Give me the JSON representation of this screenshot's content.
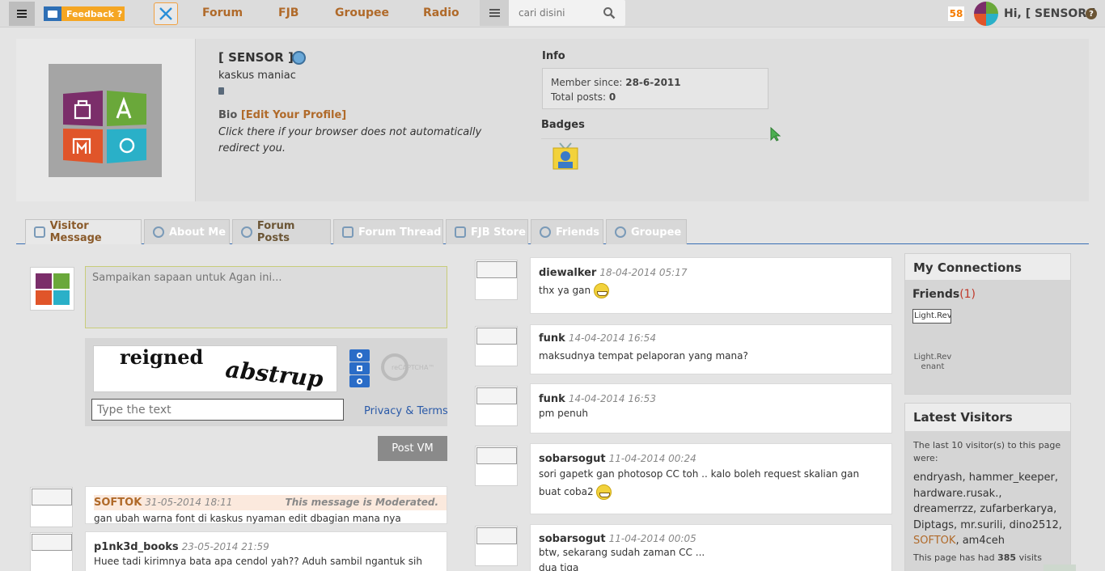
{
  "topbar": {
    "feedback_label": "Feedback ?",
    "nav": [
      "Forum",
      "FJB",
      "Groupee",
      "Radio"
    ],
    "search_placeholder": "cari disini",
    "notification_count": "58",
    "greeting": "Hi, [ SENSOR ]",
    "help_label": "?"
  },
  "profile": {
    "username": "[ SENSOR ]",
    "title": "kaskus maniac",
    "bio_label": "Bio",
    "edit_profile": "[Edit Your Profile]",
    "bio_text": "Click there if your browser does not automatically redirect you.",
    "info_title": "Info",
    "member_since_label": "Member since:",
    "member_since": "28-6-2011",
    "total_posts_label": "Total posts:",
    "total_posts": "0",
    "badges_title": "Badges"
  },
  "tabs": [
    {
      "label": "Visitor Message",
      "icon": "note-icon",
      "active": true
    },
    {
      "label": "About Me",
      "icon": "person-icon",
      "active": false
    },
    {
      "label": "Forum Posts",
      "icon": "chat-bubble-icon",
      "active": false
    },
    {
      "label": "Forum Thread",
      "icon": "calendar-icon",
      "active": false
    },
    {
      "label": "FJB Store",
      "icon": "cart-icon",
      "active": false
    },
    {
      "label": "Friends",
      "icon": "friend-icon",
      "active": false
    },
    {
      "label": "Groupee",
      "icon": "group-icon",
      "active": false
    }
  ],
  "visitor_message": {
    "placeholder": "Sampaikan sapaan untuk Agan ini...",
    "captcha_words": [
      "reigned",
      "abstrup"
    ],
    "captcha_placeholder": "Type the text",
    "recaptcha_label": "reCAPTCHA™",
    "privacy_terms": "Privacy & Terms",
    "post_button": "Post VM"
  },
  "left_messages": [
    {
      "user": "SOFTOK",
      "date": "31-05-2014 18:11",
      "moderated": "This message is Moderated.",
      "body": "gan ubah warna font di kaskus nyaman edit dbagian mana nya"
    },
    {
      "user": "p1nk3d_books",
      "date": "23-05-2014 21:59",
      "body": "Huee tadi kirimnya bata apa cendol yah?? Aduh sambil ngantuk sih soalnya."
    }
  ],
  "right_messages": [
    {
      "user": "diewalker",
      "date": "18-04-2014 05:17",
      "body": "thx ya gan",
      "smiley": true
    },
    {
      "user": "funk",
      "date": "14-04-2014 16:54",
      "body": "maksudnya tempat pelaporan yang mana?",
      "smiley": false
    },
    {
      "user": "funk",
      "date": "14-04-2014 16:53",
      "body": "pm penuh",
      "smiley": false
    },
    {
      "user": "sobarsogut",
      "date": "11-04-2014 00:24",
      "body": "sori gapetk gan photosop CC toh .. kalo boleh request skalian gan buat coba2",
      "smiley": true
    },
    {
      "user": "sobarsogut",
      "date": "11-04-2014 00:05",
      "body": "btw, sekarang sudah zaman CC ...",
      "body2": "dua tiga",
      "smiley": false
    }
  ],
  "connections": {
    "title": "My Connections",
    "friends_label": "Friends",
    "friends_count": "(1)",
    "friend_thumb": "Light.Rev",
    "friend_name": "Light.Rev enant"
  },
  "latest_visitors": {
    "title": "Latest Visitors",
    "desc": "The last 10 visitor(s) to this page were:",
    "visitors": [
      "endryash",
      "hammer_keeper",
      "hardware.rusak.",
      "dreamerrzz",
      "zufarberkarya",
      "Diptags",
      "mr.surili",
      "dino2512",
      "SOFTOK",
      "am4ceh"
    ],
    "visits_prefix": "This page has had",
    "visits_count": "385",
    "visits_suffix": "visits"
  },
  "colors": {
    "accent": "#b06a2a",
    "link": "#2a5aa8",
    "tab_line": "#3a6fb5"
  }
}
